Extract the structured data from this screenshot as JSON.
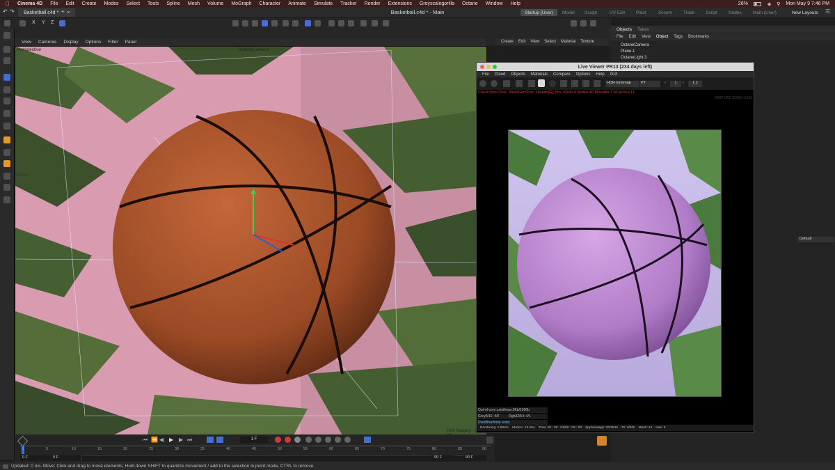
{
  "menubar": {
    "app": "Cinema 4D",
    "items": [
      "File",
      "Edit",
      "Create",
      "Modes",
      "Select",
      "Tools",
      "Spline",
      "Mesh",
      "Volume",
      "MoGraph",
      "Character",
      "Animate",
      "Simulate",
      "Tracker",
      "Render",
      "Extensions",
      "Greyscalegorilla",
      "Octane",
      "Window",
      "Help"
    ],
    "battery": "26%",
    "datetime": "Mon May 9  7:46 PM"
  },
  "document": {
    "tab": "Basketball.c4d *",
    "window_title": "Basketball.c4d * - Main"
  },
  "layouts": {
    "items": [
      "Startup (User)",
      "Model",
      "Sculpt",
      "UV Edit",
      "Paint",
      "Groom",
      "Track",
      "Script",
      "Nodes",
      "Main (User)"
    ],
    "new_layouts": "New Layouts"
  },
  "toolbar": {
    "axes": [
      "X",
      "Y",
      "Z"
    ]
  },
  "viewport": {
    "menu": [
      "View",
      "Cameras",
      "Display",
      "Options",
      "Filter",
      "Panel"
    ],
    "label": "Perspective",
    "camera": "OctaneCamera",
    "tool_label": "Move",
    "grid_spacing": "Grid Spacing : 100 cm"
  },
  "timeline": {
    "frame": "1 F",
    "ticks": [
      "0",
      "5",
      "10",
      "15",
      "20",
      "25",
      "30",
      "35",
      "40",
      "45",
      "50",
      "55",
      "60",
      "65",
      "70",
      "75",
      "80",
      "85",
      "90"
    ],
    "start": "0 F",
    "start2": "0 F",
    "end": "90 F",
    "end2": "90 F"
  },
  "status": {
    "text": "Updated: 0 ms.     Move: Click and drag to move elements. Hold down SHIFT to quantize movement / add to the selection in point mode, CTRL to remove."
  },
  "materials": {
    "menu": [
      "Create",
      "Edit",
      "View",
      "Select",
      "Material",
      "Texture"
    ]
  },
  "objects": {
    "tabs": [
      "Objects",
      "Takes"
    ],
    "menu": [
      "File",
      "Edit",
      "View",
      "Object",
      "Tags",
      "Bookmarks"
    ],
    "items": [
      "OctaneCamera",
      "Plane.1",
      "OctaneLight.3"
    ]
  },
  "attributes": {
    "preset": "Default"
  },
  "live_viewer": {
    "title": "Live Viewer PR13 (234 days left)",
    "menu": [
      "File",
      "Cloud",
      "Objects",
      "Materials",
      "Compare",
      "Options",
      "Help",
      "GUI"
    ],
    "tonemap": "HDR tonemap",
    "channel": "PT",
    "value1": "1",
    "value2": "1.2",
    "stats": "Check:0ms./0ms. MeshGen:0ms. Update[G]:0ms. Mesh:4 Nodes:40 Movable:7 txCached:11",
    "resolution": "1080*1350 ZOOM:1/139",
    "info": [
      "Out-of-core used/max:0Kb/1000b",
      "Grey8/16: 4/0",
      "Rgb32/64: 4/1",
      "Used/free/total vram: 1.326Gb/62.794Gb/64Gb",
      "Rendering: 0.904%"
    ],
    "footer": [
      "Ms/sec: 10.254",
      "Time: 00 : 00 : 04/00 : 08 : 00",
      "Spp/maxspp: 32/3540",
      "Tri: 0/40k",
      "Mesh: 12",
      "Hair: 0"
    ]
  },
  "colors": {
    "accent": "#3e6fd1",
    "viewport_bg": "#d99bb0",
    "stats_red": "#cc3a22"
  }
}
